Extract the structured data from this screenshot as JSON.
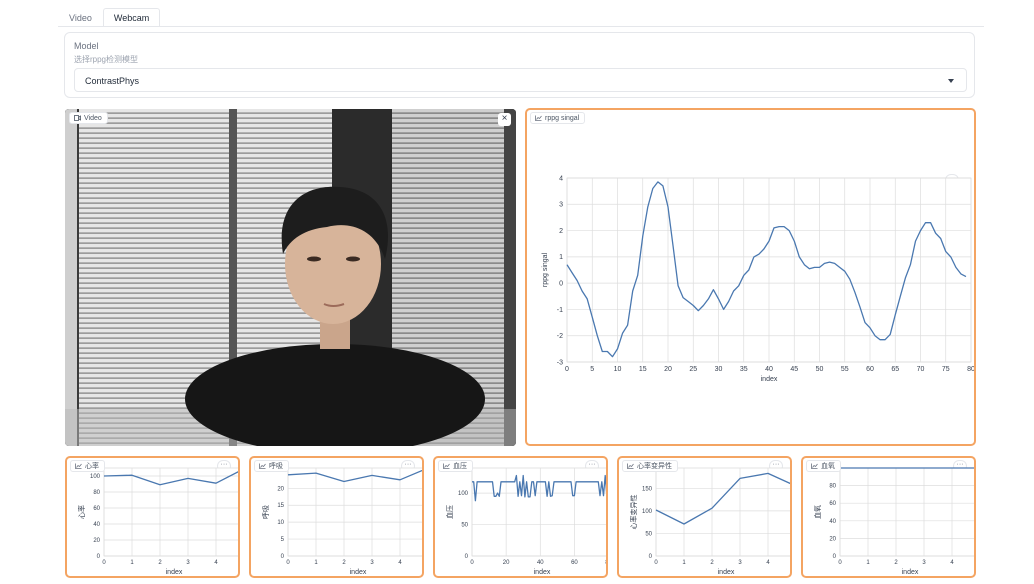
{
  "tabs": [
    {
      "label": "Video",
      "active": false
    },
    {
      "label": "Webcam",
      "active": true
    }
  ],
  "model": {
    "label": "Model",
    "info": "选择rppg检测模型",
    "selected": "ContrastPhys"
  },
  "video": {
    "label": "Video",
    "close_symbol": "×"
  },
  "more_symbol": "···",
  "colors": {
    "accent": "#f4a462",
    "line": "#4a78b0",
    "grid": "#dddddd"
  },
  "chart_data": [
    {
      "type": "line",
      "label": "rppg singal",
      "xlabel": "index",
      "ylabel": "rppg singal",
      "xlim": [
        0,
        80
      ],
      "ylim": [
        -3,
        4
      ],
      "xticks": [
        0,
        5,
        10,
        15,
        20,
        25,
        30,
        35,
        40,
        45,
        50,
        55,
        60,
        65,
        70,
        75,
        80
      ],
      "yticks": [
        -3,
        -2,
        -1,
        0,
        1,
        2,
        3,
        4
      ],
      "x": [
        0,
        1,
        2,
        3,
        4,
        5,
        6,
        7,
        8,
        9,
        10,
        11,
        12,
        13,
        14,
        15,
        16,
        17,
        18,
        19,
        20,
        21,
        22,
        23,
        24,
        25,
        26,
        27,
        28,
        29,
        30,
        31,
        32,
        33,
        34,
        35,
        36,
        37,
        38,
        39,
        40,
        41,
        42,
        43,
        44,
        45,
        46,
        47,
        48,
        49,
        50,
        51,
        52,
        53,
        54,
        55,
        56,
        57,
        58,
        59,
        60,
        61,
        62,
        63,
        64,
        65,
        66,
        67,
        68,
        69,
        70,
        71,
        72,
        73,
        74,
        75,
        76,
        77,
        78,
        79,
        80
      ],
      "y": [
        0.7,
        0.4,
        0.1,
        -0.3,
        -0.6,
        -1.3,
        -2.0,
        -2.6,
        -2.6,
        -2.8,
        -2.5,
        -1.9,
        -1.6,
        -0.3,
        0.3,
        1.8,
        2.9,
        3.6,
        3.85,
        3.7,
        2.9,
        1.4,
        -0.1,
        -0.55,
        -0.7,
        -0.85,
        -1.05,
        -0.85,
        -0.6,
        -0.25,
        -0.6,
        -1.0,
        -0.7,
        -0.3,
        -0.1,
        0.3,
        0.5,
        1.0,
        1.1,
        1.3,
        1.6,
        2.1,
        2.15,
        2.15,
        2.0,
        1.6,
        1.0,
        0.7,
        0.55,
        0.6,
        0.6,
        0.75,
        0.8,
        0.75,
        0.6,
        0.45,
        0.15,
        -0.35,
        -0.9,
        -1.5,
        -1.7,
        -2.0,
        -2.15,
        -2.15,
        -1.95,
        -1.2,
        -0.5,
        0.2,
        0.7,
        1.6,
        2.0,
        2.3,
        2.3,
        1.9,
        1.7,
        1.2,
        1.0,
        0.6,
        0.35,
        0.25,
        null
      ]
    },
    {
      "type": "line",
      "label": "心率",
      "xlabel": "index",
      "ylabel": "心率",
      "xlim": [
        0,
        5
      ],
      "ylim": [
        0,
        110
      ],
      "xticks": [
        0,
        1,
        2,
        3,
        4,
        5
      ],
      "yticks": [
        0,
        20,
        40,
        60,
        80,
        100
      ],
      "x": [
        0,
        1,
        2,
        3,
        4,
        5
      ],
      "y": [
        100,
        101,
        89,
        97,
        91,
        109
      ]
    },
    {
      "type": "line",
      "label": "呼吸",
      "xlabel": "index",
      "ylabel": "呼吸",
      "xlim": [
        0,
        5
      ],
      "ylim": [
        0,
        26
      ],
      "xticks": [
        0,
        1,
        2,
        3,
        4,
        5
      ],
      "yticks": [
        0,
        5,
        10,
        15,
        20
      ],
      "x": [
        0,
        1,
        2,
        3,
        4,
        5
      ],
      "y": [
        24,
        24.5,
        22,
        23.8,
        22.5,
        26
      ]
    },
    {
      "type": "line",
      "label": "血压",
      "xlabel": "index",
      "ylabel": "血压",
      "xlim": [
        0,
        82
      ],
      "ylim": [
        0,
        140
      ],
      "xticks": [
        0,
        20,
        40,
        60,
        80
      ],
      "yticks": [
        0,
        50,
        100
      ],
      "x": [
        0,
        1,
        2,
        3,
        4,
        5,
        6,
        7,
        8,
        9,
        10,
        11,
        12,
        13,
        14,
        15,
        16,
        17,
        18,
        19,
        20,
        21,
        22,
        23,
        24,
        25,
        26,
        27,
        28,
        29,
        30,
        31,
        32,
        33,
        34,
        35,
        36,
        37,
        38,
        39,
        40,
        41,
        42,
        43,
        44,
        45,
        46,
        47,
        48,
        49,
        50,
        51,
        52,
        53,
        54,
        55,
        56,
        57,
        58,
        59,
        60,
        61,
        62,
        63,
        64,
        65,
        66,
        67,
        68,
        69,
        70,
        71,
        72,
        73,
        74,
        75,
        76,
        77,
        78,
        79,
        80
      ],
      "y": [
        118,
        118,
        88,
        118,
        118,
        118,
        118,
        118,
        118,
        118,
        118,
        118,
        118,
        95,
        95,
        100,
        95,
        118,
        118,
        118,
        118,
        118,
        118,
        118,
        118,
        118,
        128,
        95,
        118,
        96,
        128,
        94,
        118,
        94,
        94,
        118,
        118,
        96,
        118,
        118,
        118,
        118,
        118,
        118,
        95,
        118,
        95,
        96,
        118,
        118,
        118,
        118,
        118,
        118,
        118,
        118,
        118,
        118,
        118,
        96,
        96,
        118,
        118,
        118,
        118,
        118,
        118,
        118,
        118,
        118,
        118,
        118,
        118,
        118,
        118,
        96,
        118,
        96,
        128,
        95,
        110
      ]
    },
    {
      "type": "line",
      "label": "心率变异性",
      "xlabel": "index",
      "ylabel": "心率变异性",
      "xlim": [
        0,
        5
      ],
      "ylim": [
        0,
        195
      ],
      "xticks": [
        0,
        1,
        2,
        3,
        4,
        5
      ],
      "yticks": [
        0,
        50,
        100,
        150
      ],
      "x": [
        0,
        1,
        2,
        3,
        4,
        5
      ],
      "y": [
        102,
        71,
        106,
        172,
        183,
        155
      ]
    },
    {
      "type": "line",
      "label": "血氧",
      "xlabel": "index",
      "ylabel": "血氧",
      "xlim": [
        0,
        5
      ],
      "ylim": [
        0,
        100
      ],
      "xticks": [
        0,
        1,
        2,
        3,
        4,
        5
      ],
      "yticks": [
        0,
        20,
        40,
        60,
        80
      ],
      "x": [
        0,
        1,
        2,
        3,
        4,
        5
      ],
      "y": [
        100,
        100,
        100,
        100,
        100,
        100
      ]
    }
  ]
}
